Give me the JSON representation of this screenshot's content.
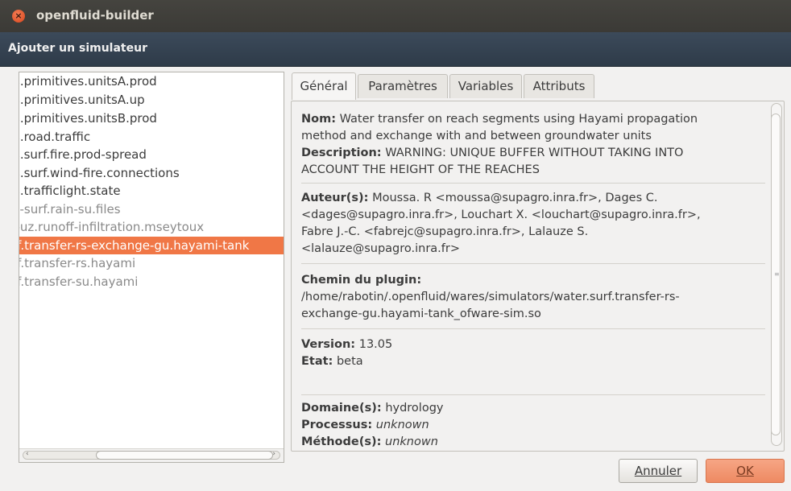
{
  "window": {
    "title": "openfluid-builder"
  },
  "dialog": {
    "title": "Ajouter un simulateur"
  },
  "simulators": [
    {
      "label": "s.primitives.unitsA.prod"
    },
    {
      "label": "s.primitives.unitsA.up"
    },
    {
      "label": "s.primitives.unitsB.prod"
    },
    {
      "label": "s.road.traffic"
    },
    {
      "label": "s.surf.fire.prod-spread"
    },
    {
      "label": "s.surf.wind-fire.connections"
    },
    {
      "label": "s.trafficlight.state"
    },
    {
      "label": "n-surf.rain-su.files"
    },
    {
      "label": "f-uz.runoff-infiltration.mseytoux"
    },
    {
      "label": "rf.transfer-rs-exchange-gu.hayami-tank"
    },
    {
      "label": "rf.transfer-rs.hayami"
    },
    {
      "label": "rf.transfer-su.hayami"
    }
  ],
  "tabs": [
    "Général",
    "Paramètres",
    "Variables",
    "Attributs"
  ],
  "info": {
    "nom_label": "Nom:",
    "nom_line1": "Water transfer on reach segments using Hayami propagation",
    "nom_line2": "method and exchange with and between groundwater units",
    "desc_label": "Description:",
    "desc_line1": "WARNING: UNIQUE BUFFER WITHOUT TAKING INTO",
    "desc_line2": "ACCOUNT THE HEIGHT OF THE REACHES",
    "auteurs_label": "Auteur(s):",
    "auteurs_line1": "Moussa. R <moussa@supagro.inra.fr>, Dages C.",
    "auteurs_line2": "<dages@supagro.inra.fr>, Louchart X. <louchart@supagro.inra.fr>,",
    "auteurs_line3": "Fabre J.-C. <fabrejc@supagro.inra.fr>, Lalauze S.",
    "auteurs_line4": "<lalauze@supagro.inra.fr>",
    "chemin_label": "Chemin du plugin:",
    "chemin_line1": "/home/rabotin/.openfluid/wares/simulators/water.surf.transfer-rs-",
    "chemin_line2": "exchange-gu.hayami-tank_ofware-sim.so",
    "version_label": "Version:",
    "version_value": "13.05",
    "etat_label": "Etat:",
    "etat_value": "beta",
    "domaine_label": "Domaine(s):",
    "domaine_value": "hydrology",
    "processus_label": "Processus:",
    "processus_value": "unknown",
    "methode_label": "Méthode(s):",
    "methode_value": "unknown"
  },
  "buttons": {
    "cancel": "Annuler",
    "ok": "OK"
  },
  "colors": {
    "selection": "#f07746",
    "ok_button": "#ee8a62",
    "dialog_header": "#2e3b49"
  }
}
